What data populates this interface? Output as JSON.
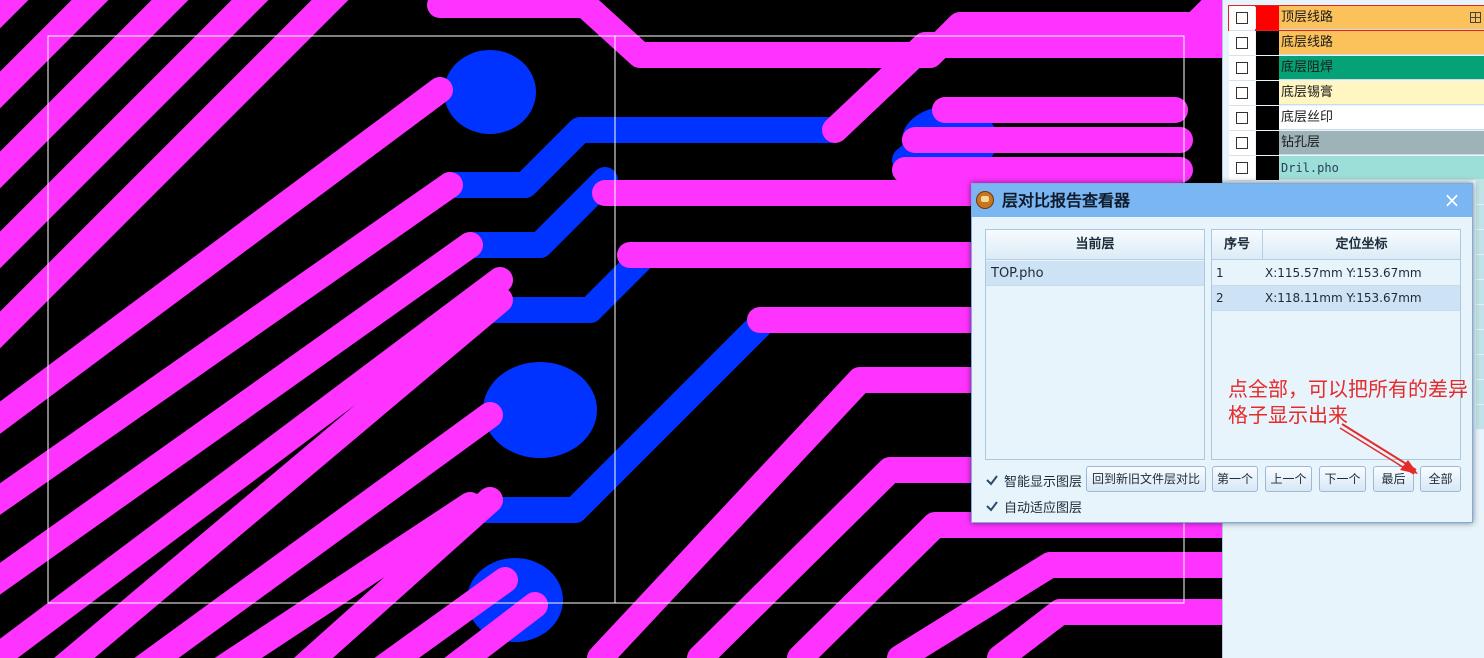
{
  "layers": [
    {
      "label": "顶层线路",
      "bg": "#fbc15a",
      "swatch": "#ff0000",
      "selected": true
    },
    {
      "label": "底层线路",
      "bg": "#fbc15a",
      "swatch": "#000000"
    },
    {
      "label": "底层阻焊",
      "bg": "#05a276",
      "swatch": "#000000"
    },
    {
      "label": "底层锡膏",
      "bg": "#fff6c2",
      "swatch": "#000000"
    },
    {
      "label": "底层丝印",
      "bg": "#ffffff",
      "swatch": "#000000"
    },
    {
      "label": "钻孔层",
      "bg": "#9db3b8",
      "swatch": "#000000"
    },
    {
      "label": "Dril.pho",
      "bg": "#9cded8",
      "swatch": "#000000"
    }
  ],
  "dialog": {
    "title": "层对比报告查看器",
    "close_icon": "×",
    "left_header": "当前层",
    "left_items": [
      "TOP.pho"
    ],
    "col_index": "序号",
    "col_coord": "定位坐标",
    "rows": [
      {
        "index": "1",
        "coord": "X:115.57mm Y:153.67mm"
      },
      {
        "index": "2",
        "coord": "X:118.11mm Y:153.67mm"
      }
    ],
    "smart_display": "智能显示图层",
    "auto_fit": "自动适应图层",
    "back_button": "回到新旧文件层对比",
    "first_button": "第一个",
    "prev_button": "上一个",
    "next_button": "下一个",
    "last_button": "最后",
    "all_button": "全部",
    "annotation": "点全部，可以把所有的差异格子显示出来"
  },
  "colors": {
    "trace_top": "#ff33ff",
    "trace_bottom": "#0033ff",
    "annotation": "#e52a2a"
  }
}
